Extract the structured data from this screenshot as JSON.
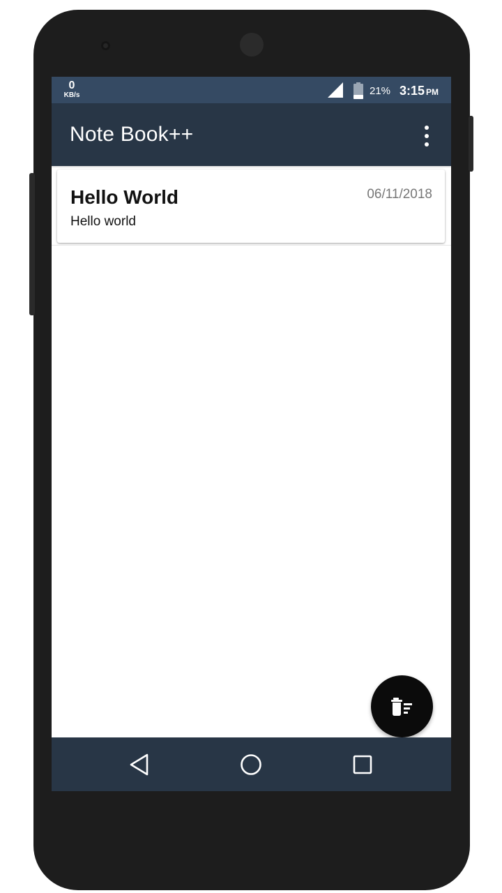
{
  "status_bar": {
    "net_speed_value": "0",
    "net_speed_unit": "KB/s",
    "signal_icon": "signal-icon",
    "battery_icon": "battery-icon",
    "battery_percent": "21%",
    "time": "3:15",
    "time_suffix": "PM"
  },
  "app_bar": {
    "title": "Note Book++",
    "overflow_icon": "more-vert-icon"
  },
  "notes": [
    {
      "title": "Hello World",
      "date": "06/11/2018",
      "body": "Hello world"
    }
  ],
  "fabs": {
    "delete_icon": "delete-sweep-icon",
    "edit_icon": "pencil-icon"
  },
  "nav_bar": {
    "back_icon": "back-icon",
    "home_icon": "home-icon",
    "recents_icon": "recents-icon"
  },
  "colors": {
    "status_bar": "#354a63",
    "app_bar": "#283646",
    "nav_bar": "#283646",
    "fab": "#0b0b0b",
    "phone_body": "#1d1d1d"
  }
}
